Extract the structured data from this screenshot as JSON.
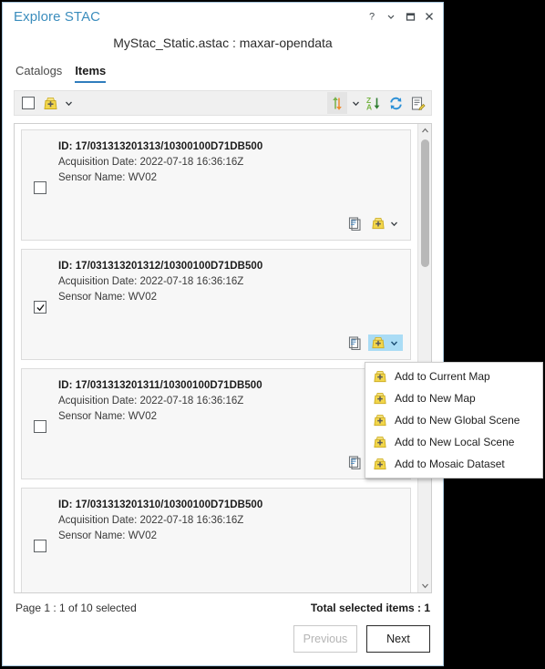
{
  "window": {
    "title": "Explore STAC",
    "controls": [
      {
        "name": "help-button",
        "glyph": "?"
      },
      {
        "name": "chevron-down-icon",
        "glyph": "˅"
      },
      {
        "name": "maximize-button",
        "glyph": "□"
      },
      {
        "name": "close-button",
        "glyph": "✕"
      }
    ],
    "subtitle": "MyStac_Static.astac : maxar-opendata",
    "accent_color": "#3b8dbd"
  },
  "tabs": [
    {
      "label": "Catalogs",
      "active": false
    },
    {
      "label": "Items",
      "active": true
    }
  ],
  "toolbar": {
    "select_all_checked": false,
    "add_label": "add-to-map",
    "left_items": [
      "select-all-checkbox",
      "add-icon",
      "add-dropdown-chevron"
    ],
    "right_items": [
      "sort-order-icon",
      "sort-dropdown-chevron",
      "sort-za-icon",
      "refresh-icon",
      "edit-query-icon"
    ]
  },
  "items": [
    {
      "id_label": "ID: 17/031313201313/10300100D71DB500",
      "date_label": "Acquisition Date: 2022-07-18 16:36:16Z",
      "sensor_label": "Sensor Name: WV02",
      "checked": false,
      "menu_open": false
    },
    {
      "id_label": "ID: 17/031313201312/10300100D71DB500",
      "date_label": "Acquisition Date: 2022-07-18 16:36:16Z",
      "sensor_label": "Sensor Name: WV02",
      "checked": true,
      "menu_open": true
    },
    {
      "id_label": "ID: 17/031313201311/10300100D71DB500",
      "date_label": "Acquisition Date: 2022-07-18 16:36:16Z",
      "sensor_label": "Sensor Name: WV02",
      "checked": false,
      "menu_open": false
    },
    {
      "id_label": "ID: 17/031313201310/10300100D71DB500",
      "date_label": "Acquisition Date: 2022-07-18 16:36:16Z",
      "sensor_label": "Sensor Name: WV02",
      "checked": false,
      "menu_open": false
    }
  ],
  "context_menu": {
    "items": [
      {
        "label": "Add to Current  Map",
        "icon": "add-layer-icon"
      },
      {
        "label": "Add to New Map",
        "icon": "add-layer-icon"
      },
      {
        "label": "Add to New Global Scene",
        "icon": "add-layer-icon"
      },
      {
        "label": "Add to New Local Scene",
        "icon": "add-layer-icon"
      },
      {
        "label": "Add to Mosaic Dataset",
        "icon": "add-layer-icon"
      }
    ]
  },
  "footer": {
    "page_status": "Page 1 : 1 of 10 selected",
    "total_selected": "Total selected items : 1",
    "previous_label": "Previous",
    "previous_enabled": false,
    "next_label": "Next",
    "next_enabled": true
  },
  "colors": {
    "title_blue": "#3b8dbd",
    "tab_underline": "#2f7dbd",
    "active_button_bg": "#aadcf5",
    "add_icon_yellow": "#f2d64b",
    "page_background": "#000000"
  }
}
